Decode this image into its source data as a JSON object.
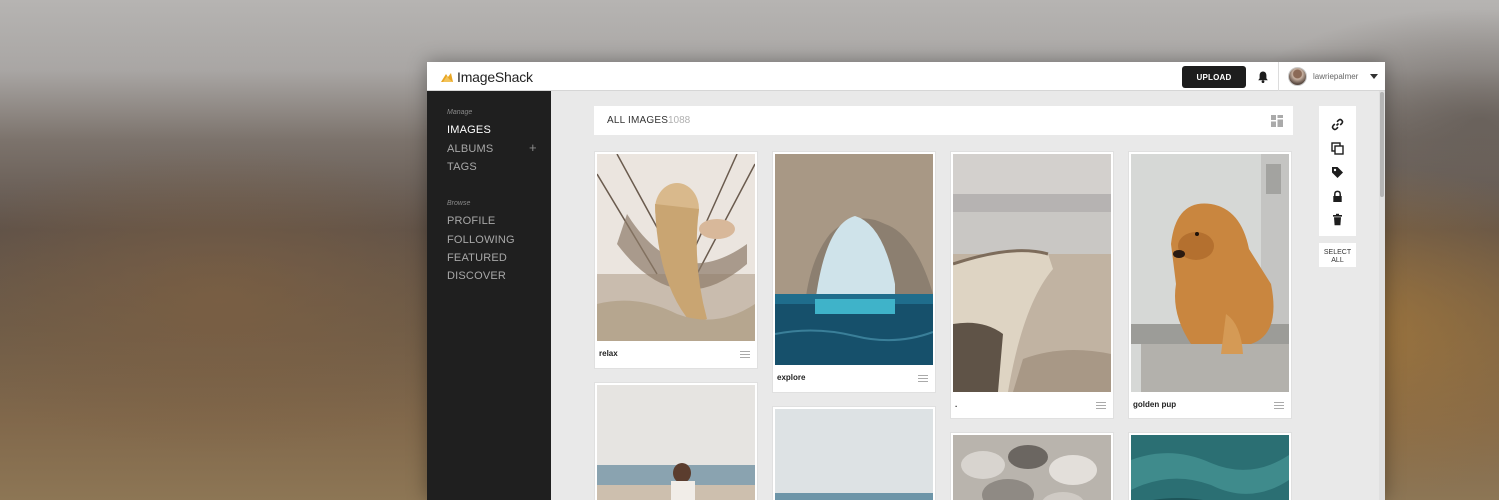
{
  "header": {
    "logo_text": "ImageShack",
    "upload_label": "UPLOAD",
    "username": "lawriepalmer"
  },
  "sidebar": {
    "manage_heading": "Manage",
    "manage_items": [
      {
        "label": "IMAGES",
        "active": true
      },
      {
        "label": "ALBUMS",
        "active": false
      },
      {
        "label": "TAGS",
        "active": false
      }
    ],
    "albums_add_symbol": "+",
    "browse_heading": "Browse",
    "browse_items": [
      {
        "label": "PROFILE"
      },
      {
        "label": "FOLLOWING"
      },
      {
        "label": "FEATURED"
      },
      {
        "label": "DISCOVER"
      }
    ]
  },
  "toolbar": {
    "title": "ALL IMAGES",
    "count": "1088"
  },
  "images": [
    {
      "caption": "relax",
      "subject": "woman in hammock"
    },
    {
      "caption": "explore",
      "subject": "sea cave with blue water"
    },
    {
      "caption": ".",
      "subject": "wooden boat on beach"
    },
    {
      "caption": "golden pup",
      "subject": "golden retriever on bench"
    },
    {
      "caption": "",
      "subject": "couple on beach"
    },
    {
      "caption": "",
      "subject": "sea horizon"
    },
    {
      "caption": "",
      "subject": "mussel shells"
    },
    {
      "caption": "",
      "subject": "ocean water"
    }
  ],
  "actions": {
    "select_all_line1": "SELECT",
    "select_all_line2": "ALL",
    "icons": [
      "link-icon",
      "duplicate-icon",
      "tag-icon",
      "lock-icon",
      "trash-icon"
    ]
  },
  "colors": {
    "sidebar_bg": "#1f1f1f",
    "upload_bg": "#1d1d1d",
    "logo_accent": "#e8a624",
    "content_bg": "#e9e9e9"
  }
}
